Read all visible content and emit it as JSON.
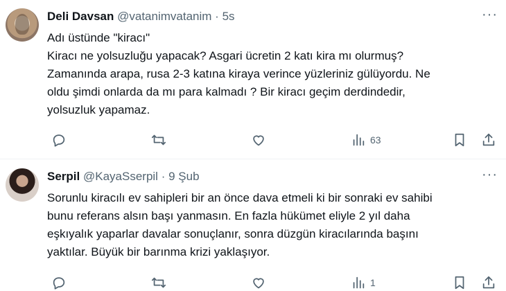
{
  "tweets": [
    {
      "author_name": "Deli Davsan",
      "handle": "@vatanimvatanim",
      "separator": "·",
      "time": "5s",
      "more_label": "···",
      "text": "Adı üstünde \"kiracı\"\nKiracı ne yolsuzluğu yapacak? Asgari ücretin 2 katı kira mı olurmuş?\nZamanında arapa, rusa 2-3 katına kiraya verince yüzleriniz gülüyordu. Ne\noldu şimdi onlarda da mı para kalmadı ?  Bir kiracı geçim derdindedir,\nyolsuzluk yapamaz.",
      "views": "63",
      "icons": [
        "reply-icon",
        "retweet-icon",
        "like-icon",
        "views-icon",
        "bookmark-icon",
        "share-icon"
      ]
    },
    {
      "author_name": "Serpil",
      "handle": "@KayaSserpil",
      "separator": "·",
      "time": "9 Şub",
      "more_label": "···",
      "text": "Sorunlu kiracılı ev sahipleri bir an önce dava etmeli ki bir sonraki ev sahibi\nbunu referans alsın başı yanmasın. En fazla hükümet eliyle 2 yıl daha\neşkıyalık yaparlar davalar sonuçlanır, sonra düzgün kiracılarında başını\nyaktılar. Büyük bir barınma krizi yaklaşıyor.",
      "views": "1",
      "icons": [
        "reply-icon",
        "retweet-icon",
        "like-icon",
        "views-icon",
        "bookmark-icon",
        "share-icon"
      ]
    }
  ],
  "colors": {
    "text": "#0f1419",
    "secondary": "#536471",
    "divider": "#eff3f4",
    "background": "#ffffff"
  }
}
